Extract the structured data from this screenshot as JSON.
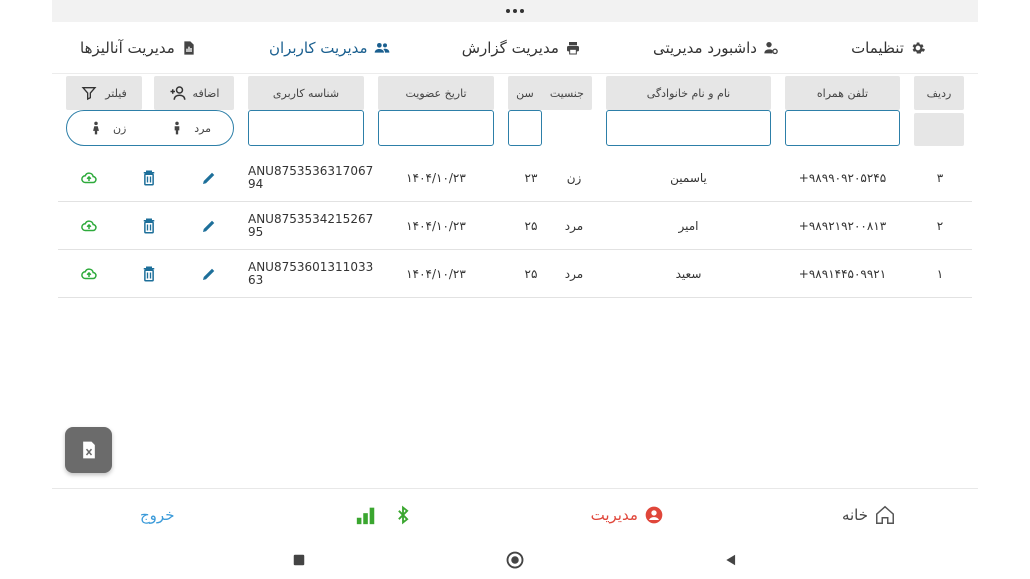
{
  "tabs": [
    {
      "label": "تنظیمات",
      "icon": "gear-icon",
      "active": false
    },
    {
      "label": "داشبورد مدیریتی",
      "icon": "user-gear-icon",
      "active": false
    },
    {
      "label": "مدیریت گزارش",
      "icon": "printer-icon",
      "active": false
    },
    {
      "label": "مدیریت کاربران",
      "icon": "users-icon",
      "active": true
    },
    {
      "label": "مدیریت آنالیزها",
      "icon": "report-file-icon",
      "active": false
    }
  ],
  "headers": {
    "row_num": "ردیف",
    "phone": "تلفن همراه",
    "name": "نام و نام خانوادگی",
    "gender": "جنسیت",
    "age": "سن",
    "join_date": "تاریخ عضویت",
    "user_id": "شناسه کاربری",
    "add": "اضافه",
    "filter": "فیلتر"
  },
  "gender_filter": {
    "male": "مرد",
    "female": "زن"
  },
  "rows": [
    {
      "num": "۳",
      "phone": "+۹۸۹۹۰۹۲۰۵۲۴۵",
      "name": "یاسمین",
      "gender": "زن",
      "age": "۲۳",
      "date": "۱۴۰۴/۱۰/۲۳",
      "id_line1": "ANU8753536317067",
      "id_line2": "94"
    },
    {
      "num": "۲",
      "phone": "+۹۸۹۲۱۹۲۰۰۸۱۳",
      "name": "امیر",
      "gender": "مرد",
      "age": "۲۵",
      "date": "۱۴۰۴/۱۰/۲۳",
      "id_line1": "ANU8753534215267",
      "id_line2": "95"
    },
    {
      "num": "۱",
      "phone": "+۹۸۹۱۴۴۵۰۹۹۲۱",
      "name": "سعید",
      "gender": "مرد",
      "age": "۲۵",
      "date": "۱۴۰۴/۱۰/۲۳",
      "id_line1": "ANU8753601311033",
      "id_line2": "63"
    }
  ],
  "bottom_nav": {
    "home": "خانه",
    "manage": "مدیریت",
    "logout": "خروج"
  },
  "colors": {
    "accent_blue": "#1a5f8f",
    "input_border": "#2d7fa8",
    "upload_green": "#2eaa3c",
    "delete_blue": "#1d6f9a",
    "edit_blue": "#1d6f9a",
    "manage_red": "#e0463a",
    "signal_green": "#3aa62f",
    "bluetooth_green": "#3aa62f",
    "logout_blue": "#3a9ad9"
  }
}
